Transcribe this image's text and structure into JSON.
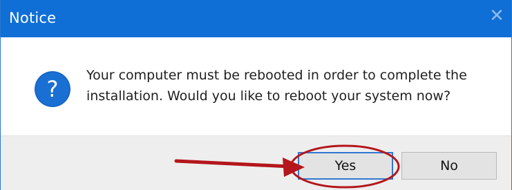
{
  "window": {
    "title": "Notice",
    "close_glyph": "✕"
  },
  "dialog": {
    "icon": "question-mark-icon",
    "message": "Your computer must be rebooted in order to complete the installation. Would you like to reboot your system now?"
  },
  "buttons": {
    "yes_label": "Yes",
    "no_label": "No"
  },
  "colors": {
    "titlebar": "#0f6fd6",
    "icon": "#1766c8",
    "annotation": "#b4161b",
    "default_button_border": "#2f76d2"
  },
  "annotation": {
    "type": "red-circle-and-arrow",
    "target": "yes-button"
  }
}
